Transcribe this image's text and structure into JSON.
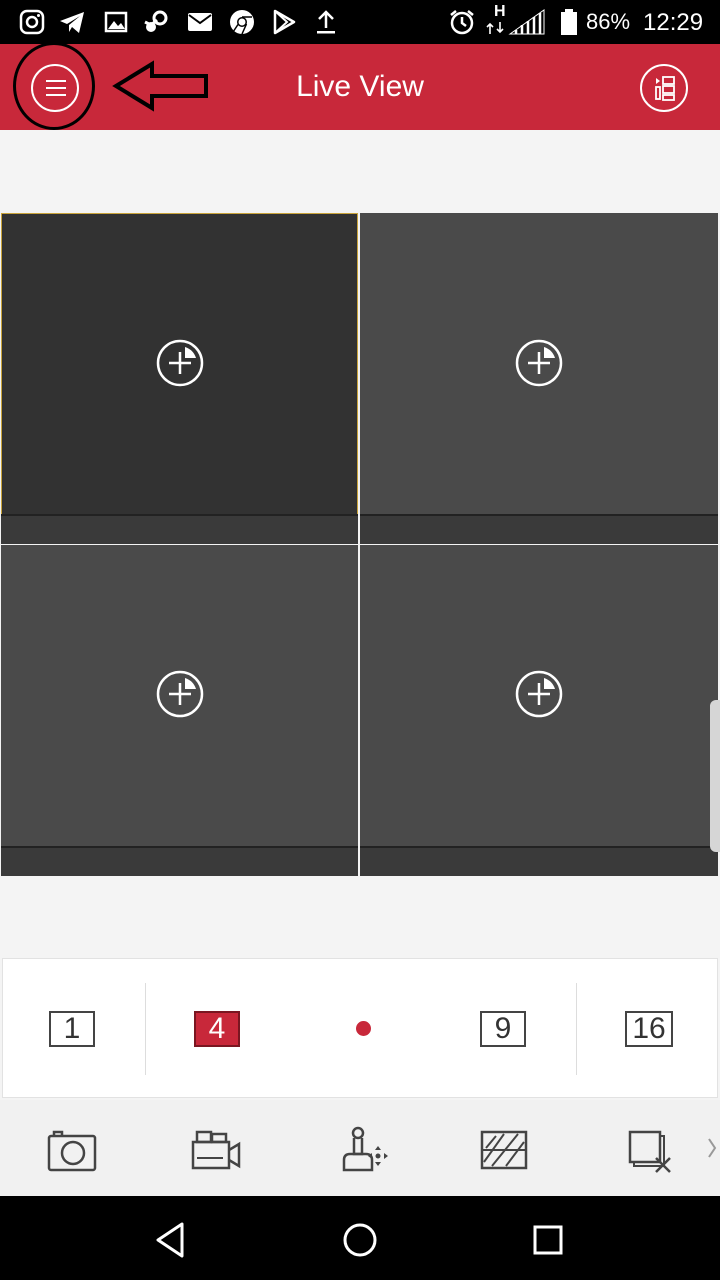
{
  "status_bar": {
    "battery_percent": "86%",
    "time": "12:29",
    "network_type": "H",
    "notification_icons": [
      "instagram-icon",
      "telegram-icon",
      "gallery-icon",
      "steam-icon",
      "mail-icon",
      "chrome-icon",
      "play-store-icon",
      "upload-icon"
    ],
    "system_icons": [
      "alarm-icon",
      "signal-icon",
      "battery-icon"
    ]
  },
  "app_bar": {
    "title": "Live View",
    "left_icon": "menu-icon",
    "right_icon": "layout-list-icon",
    "background_color": "#c8283a"
  },
  "video_grid": {
    "tiles": [
      {
        "id": "1",
        "state": "empty",
        "active": true,
        "icon": "add-camera-icon"
      },
      {
        "id": "2",
        "state": "empty",
        "active": false,
        "icon": "add-camera-icon"
      },
      {
        "id": "3",
        "state": "empty",
        "active": false,
        "icon": "add-camera-icon"
      },
      {
        "id": "4",
        "state": "empty",
        "active": false,
        "icon": "add-camera-icon"
      }
    ]
  },
  "split_selector": {
    "options": [
      "1",
      "4",
      "9",
      "16"
    ],
    "selected": "4",
    "page_indicator_count": 1
  },
  "tool_bar": {
    "tools": [
      "snapshot-icon",
      "record-icon",
      "ptz-control-icon",
      "image-quality-icon",
      "close-all-icon"
    ],
    "more_icon": "chevron-right-icon"
  },
  "nav_bar": {
    "buttons": [
      "back-icon",
      "home-icon",
      "recents-icon"
    ]
  }
}
